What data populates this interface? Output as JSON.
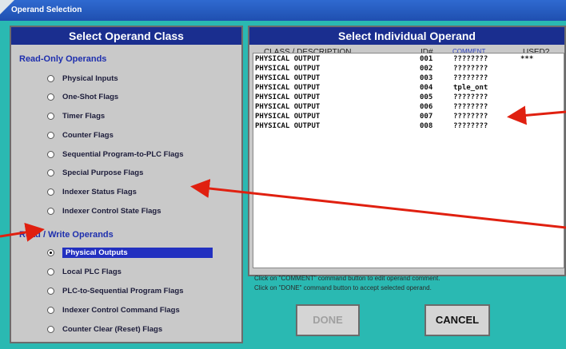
{
  "window": {
    "title": "Operand Selection"
  },
  "left": {
    "header": "Select Operand Class",
    "read_only_label": "Read-Only Operands",
    "read_only_items": [
      "Physical Inputs",
      "One-Shot Flags",
      "Timer Flags",
      "Counter Flags",
      "Sequential Program-to-PLC Flags",
      "Special Purpose Flags",
      "Indexer Status Flags",
      "Indexer Control State Flags"
    ],
    "read_write_label": "Read / Write Operands",
    "read_write_items": [
      "Physical Outputs",
      "Local PLC Flags",
      "PLC-to-Sequential Program Flags",
      "Indexer Control Command Flags",
      "Counter Clear (Reset) Flags"
    ],
    "selected_item": "Physical Outputs"
  },
  "right": {
    "header": "Select Individual Operand",
    "columns": [
      "CLASS / DESCRIPTION",
      "ID#",
      "COMMENT",
      "USED?"
    ],
    "rows": [
      {
        "desc": "PHYSICAL OUTPUT",
        "id": "001",
        "comment": "????????",
        "used": "***"
      },
      {
        "desc": "PHYSICAL OUTPUT",
        "id": "002",
        "comment": "????????",
        "used": ""
      },
      {
        "desc": "PHYSICAL OUTPUT",
        "id": "003",
        "comment": "????????",
        "used": ""
      },
      {
        "desc": "PHYSICAL OUTPUT",
        "id": "004",
        "comment": "tple_ont",
        "used": ""
      },
      {
        "desc": "PHYSICAL OUTPUT",
        "id": "005",
        "comment": "????????",
        "used": ""
      },
      {
        "desc": "PHYSICAL OUTPUT",
        "id": "006",
        "comment": "????????",
        "used": ""
      },
      {
        "desc": "PHYSICAL OUTPUT",
        "id": "007",
        "comment": "????????",
        "used": ""
      },
      {
        "desc": "PHYSICAL OUTPUT",
        "id": "008",
        "comment": "????????",
        "used": ""
      }
    ]
  },
  "instructions": {
    "line1": "Click on \"COMMENT\" command button to edit operand comment.",
    "line2": "Click on \"DONE\" command button to accept selected operand."
  },
  "buttons": {
    "done": "DONE",
    "cancel": "CANCEL"
  },
  "colors": {
    "background": "#2ab9b2",
    "header": "#1a2e8f",
    "arrow": "#e02010"
  }
}
